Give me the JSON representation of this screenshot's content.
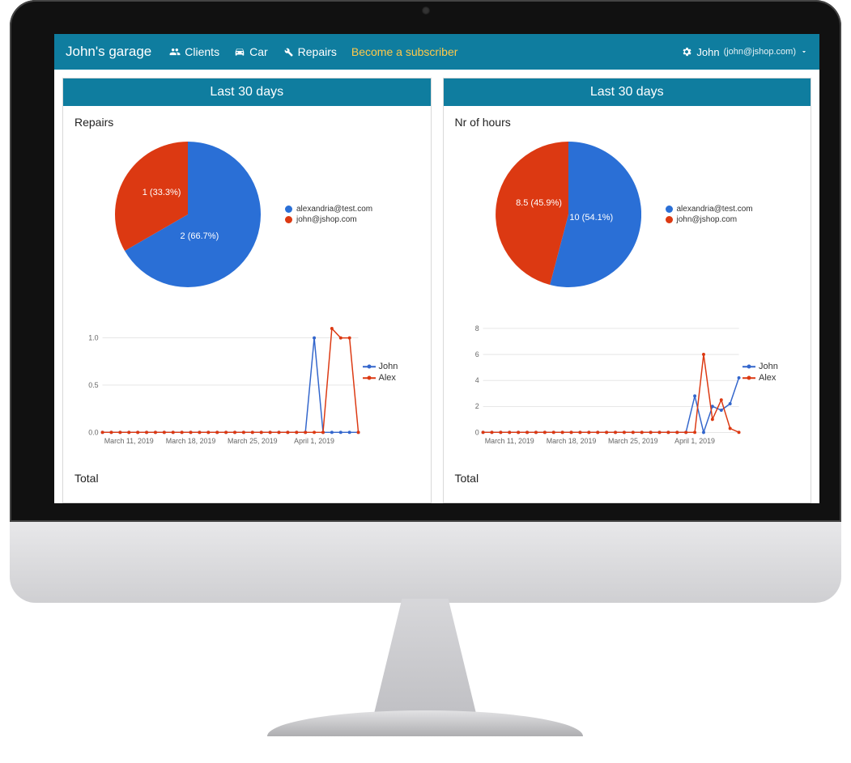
{
  "nav": {
    "brand": "John's garage",
    "clients": "Clients",
    "car": "Car",
    "repairs": "Repairs",
    "subscribe": "Become a subscriber",
    "user_name": "John",
    "user_email": "(john@jshop.com)"
  },
  "colors": {
    "blue": "#2a6fd6",
    "red": "#dc3912",
    "teal": "#0f7d9f"
  },
  "panels": {
    "left": {
      "header": "Last 30 days",
      "section": "Repairs",
      "total": "Total"
    },
    "right": {
      "header": "Last 30 days",
      "section": "Nr of hours",
      "total": "Total"
    }
  },
  "pie_legend": {
    "a": "alexandria@test.com",
    "b": "john@jshop.com"
  },
  "line_legend": {
    "a": "John",
    "b": "Alex"
  },
  "axis": {
    "x1": "March 11, 2019",
    "x2": "March 18, 2019",
    "x3": "March 25, 2019",
    "x4": "April 1, 2019",
    "l_y0": "0.0",
    "l_y1": "0.5",
    "l_y2": "1.0",
    "r_y0": "0",
    "r_y1": "2",
    "r_y2": "4",
    "r_y3": "6",
    "r_y4": "8"
  },
  "pie_labels": {
    "left_red": "1 (33.3%)",
    "left_blue": "2 (66.7%)",
    "right_red": "8.5 (45.9%)",
    "right_blue": "10 (54.1%)"
  },
  "chart_data": [
    {
      "type": "pie",
      "title": "Repairs — Last 30 days",
      "series": [
        {
          "name": "alexandria@test.com",
          "value": 2,
          "pct": 66.7,
          "color": "#2a6fd6"
        },
        {
          "name": "john@jshop.com",
          "value": 1,
          "pct": 33.3,
          "color": "#dc3912"
        }
      ]
    },
    {
      "type": "pie",
      "title": "Nr of hours — Last 30 days",
      "series": [
        {
          "name": "alexandria@test.com",
          "value": 10,
          "pct": 54.1,
          "color": "#2a6fd6"
        },
        {
          "name": "john@jshop.com",
          "value": 8.5,
          "pct": 45.9,
          "color": "#dc3912"
        }
      ]
    },
    {
      "type": "line",
      "title": "Repairs per day",
      "x": [
        "Mar 8",
        "Mar 9",
        "Mar 10",
        "Mar 11",
        "Mar 12",
        "Mar 13",
        "Mar 14",
        "Mar 15",
        "Mar 16",
        "Mar 17",
        "Mar 18",
        "Mar 19",
        "Mar 20",
        "Mar 21",
        "Mar 22",
        "Mar 23",
        "Mar 24",
        "Mar 25",
        "Mar 26",
        "Mar 27",
        "Mar 28",
        "Mar 29",
        "Mar 30",
        "Mar 31",
        "Apr 1",
        "Apr 2",
        "Apr 3",
        "Apr 4",
        "Apr 5",
        "Apr 6"
      ],
      "ylim": [
        0,
        1.1
      ],
      "series": [
        {
          "name": "John",
          "color": "#3366cc",
          "values": [
            0,
            0,
            0,
            0,
            0,
            0,
            0,
            0,
            0,
            0,
            0,
            0,
            0,
            0,
            0,
            0,
            0,
            0,
            0,
            0,
            0,
            0,
            0,
            0,
            1,
            0,
            0,
            0,
            0,
            0
          ]
        },
        {
          "name": "Alex",
          "color": "#dc3912",
          "values": [
            0,
            0,
            0,
            0,
            0,
            0,
            0,
            0,
            0,
            0,
            0,
            0,
            0,
            0,
            0,
            0,
            0,
            0,
            0,
            0,
            0,
            0,
            0,
            0,
            0,
            0,
            1.1,
            1,
            1,
            0
          ]
        }
      ]
    },
    {
      "type": "line",
      "title": "Hours per day",
      "x": [
        "Mar 8",
        "Mar 9",
        "Mar 10",
        "Mar 11",
        "Mar 12",
        "Mar 13",
        "Mar 14",
        "Mar 15",
        "Mar 16",
        "Mar 17",
        "Mar 18",
        "Mar 19",
        "Mar 20",
        "Mar 21",
        "Mar 22",
        "Mar 23",
        "Mar 24",
        "Mar 25",
        "Mar 26",
        "Mar 27",
        "Mar 28",
        "Mar 29",
        "Mar 30",
        "Mar 31",
        "Apr 1",
        "Apr 2",
        "Apr 3",
        "Apr 4",
        "Apr 5",
        "Apr 6"
      ],
      "ylim": [
        0,
        8
      ],
      "series": [
        {
          "name": "John",
          "color": "#3366cc",
          "values": [
            0,
            0,
            0,
            0,
            0,
            0,
            0,
            0,
            0,
            0,
            0,
            0,
            0,
            0,
            0,
            0,
            0,
            0,
            0,
            0,
            0,
            0,
            0,
            0,
            2.8,
            0,
            2,
            1.7,
            2.2,
            4.2
          ]
        },
        {
          "name": "Alex",
          "color": "#dc3912",
          "values": [
            0,
            0,
            0,
            0,
            0,
            0,
            0,
            0,
            0,
            0,
            0,
            0,
            0,
            0,
            0,
            0,
            0,
            0,
            0,
            0,
            0,
            0,
            0,
            0,
            0,
            6,
            1,
            2.5,
            0.3,
            0
          ]
        }
      ]
    }
  ]
}
